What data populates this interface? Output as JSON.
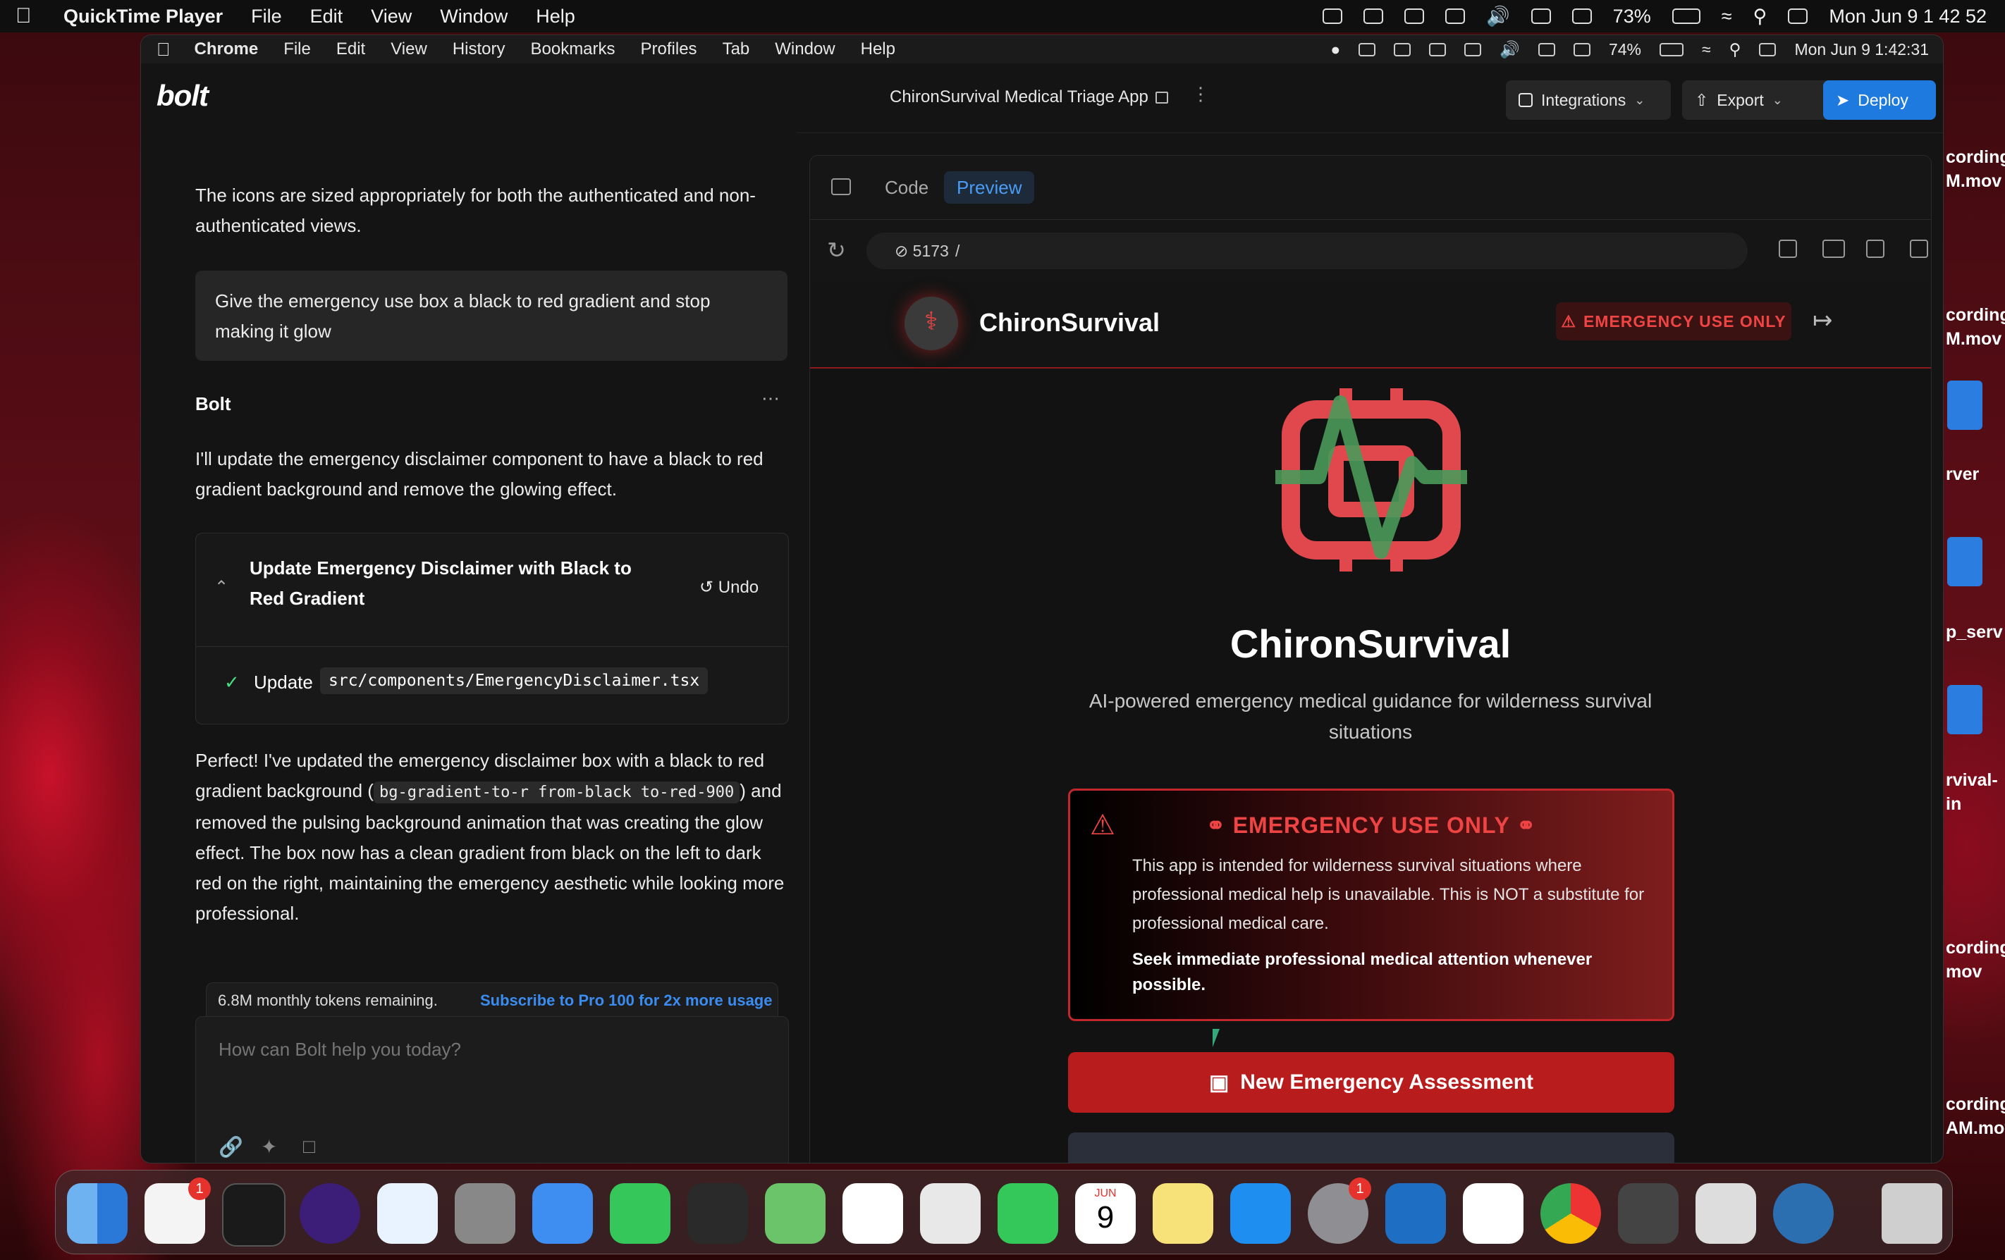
{
  "menubar": {
    "app": "QuickTime Player",
    "items": [
      "File",
      "Edit",
      "View",
      "Window",
      "Help"
    ],
    "battery": "73%",
    "clock": "Mon Jun 9  1 42 52"
  },
  "chrome_menubar": {
    "app": "Chrome",
    "items": [
      "File",
      "Edit",
      "View",
      "History",
      "Bookmarks",
      "Profiles",
      "Tab",
      "Window",
      "Help"
    ],
    "battery": "74%",
    "clock": "Mon Jun 9  1:42:31"
  },
  "header": {
    "logo": "bolt",
    "project_title": "ChironSurvival Medical Triage App",
    "integrations": "Integrations",
    "export": "Export",
    "deploy": "Deploy"
  },
  "chat": {
    "prev_message": "The icons are sized appropriately for both the authenticated and non-authenticated views.",
    "user_message": "Give the emergency use box a black to red gradient and stop making it glow",
    "assistant_name": "Bolt",
    "assistant_intro": "I'll update the emergency disclaimer component to have a black to red gradient background and remove the glowing effect.",
    "action_title": "Update Emergency Disclaimer with Black to Red Gradient",
    "undo": "Undo",
    "update_label": "Update",
    "update_file": "src/components/EmergencyDisclaimer.tsx",
    "result_1": "Perfect! I've updated the emergency disclaimer box with a black to red gradient background (",
    "result_code": "bg-gradient-to-r from-black to-red-900",
    "result_2": ") and removed the pulsing background animation that was creating the glow effect. The box now has a clean gradient from black on the left to dark red on the right, maintaining the emergency aesthetic while looking more professional.",
    "tokens": "6.8M monthly tokens remaining.",
    "subscribe": "Subscribe to Pro 100 for 2x more usage",
    "input_placeholder": "How can Bolt help you today?"
  },
  "preview": {
    "tab_code": "Code",
    "tab_preview": "Preview",
    "port": "5173",
    "path": "/"
  },
  "app": {
    "brand": "ChironSurvival",
    "badge": "EMERGENCY USE ONLY",
    "title": "ChironSurvival",
    "subtitle": "AI-powered emergency medical guidance for wilderness survival situations",
    "emergency_title": "EMERGENCY USE ONLY",
    "emergency_body": "This app is intended for wilderness survival situations where professional medical help is unavailable. This is NOT a substitute for professional medical care.",
    "emergency_bold": "Seek immediate professional medical attention whenever possible.",
    "new_assessment": "New Emergency Assessment"
  },
  "desktop_labels": [
    "cording",
    "M.mov",
    "cording",
    "M.mov",
    "rver",
    "p_serv",
    "rvival-",
    "in",
    "cording",
    "mov",
    "cording",
    "AM.mov"
  ],
  "dock": {
    "calendar_month": "JUN",
    "calendar_day": "9",
    "badges": [
      "1",
      "1"
    ]
  },
  "colors": {
    "accent_blue": "#1f7ae0",
    "emergency_red": "#ef4444",
    "button_red": "#b91c1c",
    "logo_red": "#e0484e",
    "logo_green": "#4a9a5a"
  }
}
